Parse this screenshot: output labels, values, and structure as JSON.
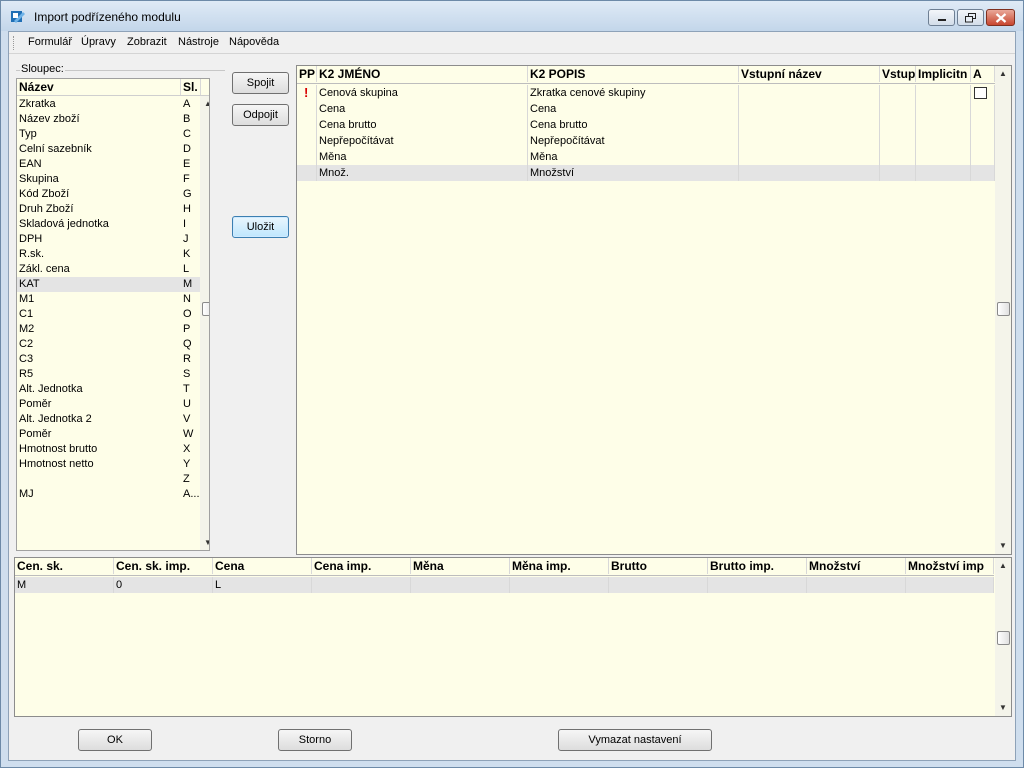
{
  "window": {
    "title": "Import podřízeného modulu"
  },
  "menu": [
    "Formulář",
    "Úpravy",
    "Zobrazit",
    "Nástroje",
    "Nápověda"
  ],
  "left": {
    "group_label": "Sloupec:",
    "headers": {
      "name": "Název",
      "col": "Sl."
    },
    "rows": [
      {
        "name": "Zkratka",
        "col": "A"
      },
      {
        "name": "Název zboží",
        "col": "B"
      },
      {
        "name": "Typ",
        "col": "C"
      },
      {
        "name": "Celní sazebník",
        "col": "D"
      },
      {
        "name": "EAN",
        "col": "E"
      },
      {
        "name": "Skupina",
        "col": "F"
      },
      {
        "name": "Kód Zboží",
        "col": "G"
      },
      {
        "name": "Druh Zboží",
        "col": "H"
      },
      {
        "name": "Skladová jednotka",
        "col": "I"
      },
      {
        "name": "DPH",
        "col": "J"
      },
      {
        "name": "R.sk.",
        "col": "K"
      },
      {
        "name": "Zákl. cena",
        "col": "L"
      },
      {
        "name": "KAT",
        "col": "M"
      },
      {
        "name": "M1",
        "col": "N"
      },
      {
        "name": "C1",
        "col": "O"
      },
      {
        "name": "M2",
        "col": "P"
      },
      {
        "name": "C2",
        "col": "Q"
      },
      {
        "name": "C3",
        "col": "R"
      },
      {
        "name": "R5",
        "col": "S"
      },
      {
        "name": "Alt. Jednotka",
        "col": "T"
      },
      {
        "name": "Poměr",
        "col": "U"
      },
      {
        "name": "Alt. Jednotka 2",
        "col": "V"
      },
      {
        "name": "Poměr",
        "col": "W"
      },
      {
        "name": "Hmotnost brutto",
        "col": "X"
      },
      {
        "name": "Hmotnost netto",
        "col": "Y"
      },
      {
        "name": "",
        "col": "Z"
      },
      {
        "name": "MJ",
        "col": "A..."
      }
    ],
    "selected_index": 12
  },
  "buttons": {
    "spojit": "Spojit",
    "odpojit": "Odpojit",
    "ulozit": "Uložit",
    "ok": "OK",
    "storno": "Storno",
    "vymazat": "Vymazat nastavení"
  },
  "right": {
    "headers": [
      "PP",
      "K2 JMÉNO",
      "K2 POPIS",
      "Vstupní název",
      "Vstup",
      "Implicitn",
      "A"
    ],
    "rows": [
      {
        "pp": "!",
        "name": "Cenová skupina",
        "desc": "Zkratka cenové skupiny",
        "checkbox": true
      },
      {
        "pp": "",
        "name": "Cena",
        "desc": "Cena",
        "checkbox": false
      },
      {
        "pp": "",
        "name": "Cena brutto",
        "desc": "Cena brutto",
        "checkbox": false
      },
      {
        "pp": "",
        "name": "Nepřepočítávat",
        "desc": "Nepřepočítávat",
        "checkbox": false
      },
      {
        "pp": "",
        "name": "Měna",
        "desc": "Měna",
        "checkbox": false
      },
      {
        "pp": "",
        "name": "Množ.",
        "desc": "Množství",
        "checkbox": false
      }
    ],
    "selected_index": 5
  },
  "bottom": {
    "headers": [
      "Cen. sk.",
      "Cen. sk. imp.",
      "Cena",
      "Cena imp.",
      "Měna",
      "Měna imp.",
      "Brutto",
      "Brutto imp.",
      "Množství",
      "Množství imp"
    ],
    "rows": [
      [
        "M",
        "0",
        "L",
        "",
        "",
        "",
        "",
        "",
        "",
        ""
      ]
    ]
  },
  "colors": {
    "grid_bg": "#fefee8",
    "selection": "#e4e4e4",
    "excl": "#d80000"
  }
}
